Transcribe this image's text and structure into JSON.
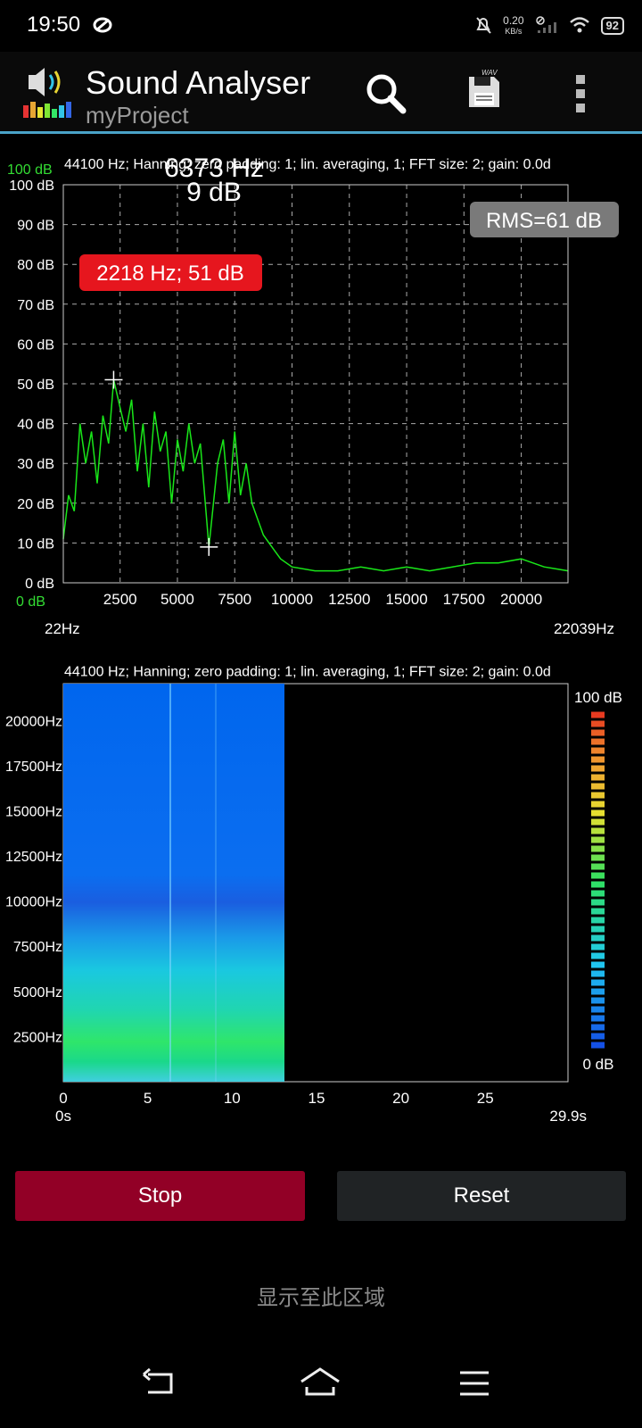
{
  "status_bar": {
    "time": "19:50",
    "net_speed_value": "0.20",
    "net_speed_unit": "KB/s",
    "battery": "92"
  },
  "app_bar": {
    "title": "Sound Analyser",
    "subtitle": "myProject"
  },
  "spectrum": {
    "info": "44100 Hz; Hanning; zero padding: 1; lin. averaging, 1; FFT size: 2; gain: 0.0d",
    "cursor_freq": "6373 Hz",
    "cursor_db": "9 dB",
    "rms_label": "RMS=61 dB",
    "peak_label": "2218 Hz; 51 dB",
    "top_db_label": "100 dB",
    "bottom_db_label": "0 dB",
    "x_min_label": "22Hz",
    "x_max_label": "22039Hz",
    "line_color": "#19e619"
  },
  "spectrogram": {
    "info": "44100 Hz; Hanning; zero padding: 1; lin. averaging, 1; FFT size: 2; gain: 0.0d",
    "y_ticks": [
      "20000Hz",
      "17500Hz",
      "15000Hz",
      "12500Hz",
      "10000Hz",
      "7500Hz",
      "5000Hz",
      "2500Hz"
    ],
    "x_ticks": [
      "0",
      "5",
      "10",
      "15",
      "20",
      "25"
    ],
    "x_start_label": "0s",
    "x_end_label": "29.9s",
    "scale_top": "100 dB",
    "scale_bottom": "0 dB",
    "recorded_seconds": 13.1,
    "total_seconds": 29.9
  },
  "chart_data": {
    "type": "line",
    "xlabel": "",
    "ylabel": "",
    "xlim": [
      22,
      22039
    ],
    "ylim": [
      0,
      100
    ],
    "x_ticks": [
      2500,
      5000,
      7500,
      10000,
      12500,
      15000,
      17500,
      20000
    ],
    "y_ticks": [
      "0 dB",
      "10 dB",
      "20 dB",
      "30 dB",
      "40 dB",
      "50 dB",
      "60 dB",
      "70 dB",
      "80 dB",
      "90 dB",
      "100 dB"
    ],
    "grid": true,
    "x": [
      22,
      250,
      500,
      750,
      1000,
      1250,
      1500,
      1750,
      2000,
      2218,
      2500,
      2750,
      3000,
      3250,
      3500,
      3750,
      4000,
      4250,
      4500,
      4750,
      5000,
      5250,
      5500,
      5750,
      6000,
      6373,
      6750,
      7000,
      7250,
      7500,
      7750,
      8000,
      8250,
      8500,
      8750,
      9000,
      9250,
      9500,
      10000,
      11000,
      12000,
      13000,
      14000,
      15000,
      16000,
      17000,
      18000,
      19000,
      20000,
      21000,
      22039
    ],
    "y": [
      11,
      22,
      18,
      40,
      30,
      38,
      25,
      42,
      35,
      51,
      44,
      38,
      46,
      28,
      40,
      24,
      43,
      33,
      38,
      20,
      36,
      28,
      40,
      30,
      35,
      9,
      30,
      36,
      20,
      38,
      22,
      30,
      20,
      16,
      12,
      10,
      8,
      6,
      4,
      3,
      3,
      4,
      3,
      4,
      3,
      4,
      5,
      5,
      6,
      4,
      3
    ]
  },
  "buttons": {
    "stop": "Stop",
    "reset": "Reset"
  },
  "footer": {
    "display_zone": "显示至此区域"
  }
}
